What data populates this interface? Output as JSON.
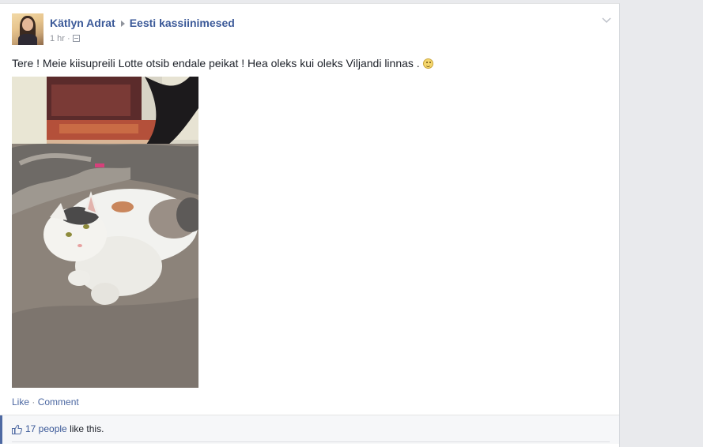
{
  "post": {
    "author": "Kätlyn Adrat",
    "group": "Eesti kassiinimesed",
    "time": "1 hr",
    "meta_separator": "·",
    "text": "Tere ! Meie kiisupreili Lotte otsib endale peikat ! Hea oleks kui oleks Viljandi linnas .",
    "photo_icon": "cat-photo"
  },
  "actions": {
    "like": "Like",
    "separator": "·",
    "comment": "Comment"
  },
  "likes": {
    "count": "17 people",
    "suffix": "like this."
  },
  "colors": {
    "link": "#3b5998",
    "accent": "#4e69a2",
    "background": "#e9eaed"
  }
}
